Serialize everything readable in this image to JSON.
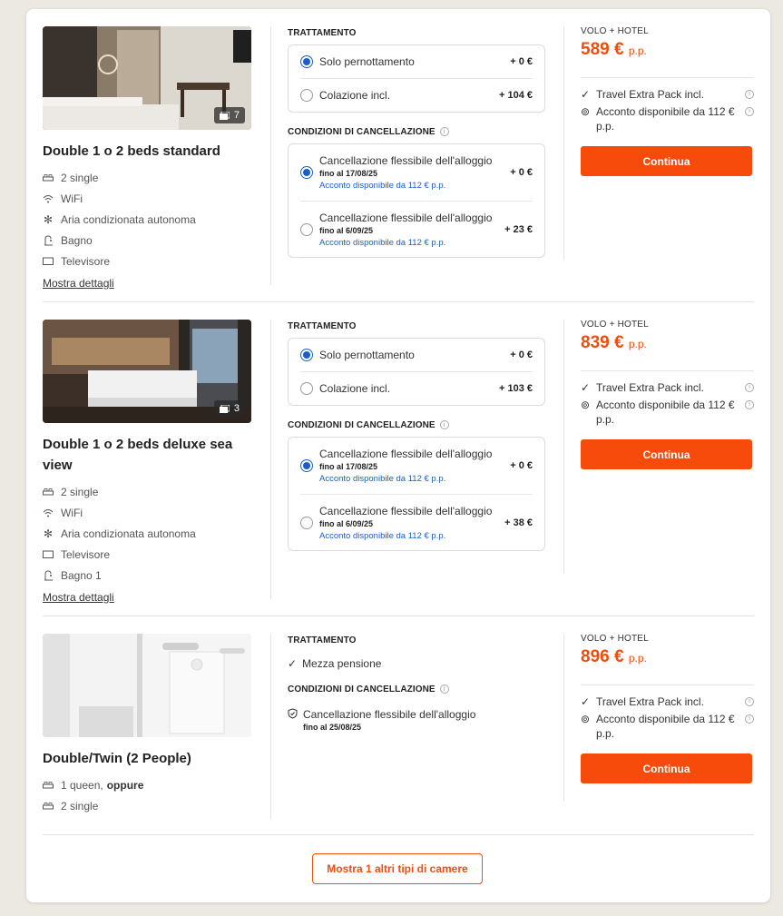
{
  "rooms": [
    {
      "photo_count": "7",
      "title": "Double 1 o 2 beds standard",
      "amenities": [
        {
          "icon": "bed-icon",
          "text": "2 single"
        },
        {
          "icon": "wifi-icon",
          "text": "WiFi"
        },
        {
          "icon": "snowflake-icon",
          "text": "Aria condizionata autonoma"
        },
        {
          "icon": "bath-icon",
          "text": "Bagno"
        },
        {
          "icon": "tv-icon",
          "text": "Televisore"
        }
      ],
      "details_link": "Mostra dettagli",
      "treatment_heading": "TRATTAMENTO",
      "treatments": [
        {
          "label": "Solo pernottamento",
          "price": "+ 0 €",
          "selected": true
        },
        {
          "label": "Colazione incl.",
          "price": "+ 104 €",
          "selected": false
        }
      ],
      "cancel_heading": "CONDIZIONI DI CANCELLAZIONE",
      "cancellations": [
        {
          "label": "Cancellazione flessibile dell'alloggio",
          "until": "fino al 17/08/25",
          "deposit": "Acconto disponibile da 112 € p.p.",
          "price": "+ 0 €",
          "selected": true
        },
        {
          "label": "Cancellazione flessibile dell'alloggio",
          "until": "fino al 6/09/25",
          "deposit": "Acconto disponibile da 112 € p.p.",
          "price": "+ 23 €",
          "selected": false
        }
      ],
      "label": "VOLO + HOTEL",
      "price": "589 €",
      "price_unit": "p.p.",
      "perk1": "Travel Extra Pack incl.",
      "perk2": "Acconto disponibile da 112 € p.p.",
      "button": "Continua"
    },
    {
      "photo_count": "3",
      "title": "Double 1 o 2 beds deluxe sea view",
      "amenities": [
        {
          "icon": "bed-icon",
          "text": "2 single"
        },
        {
          "icon": "wifi-icon",
          "text": "WiFi"
        },
        {
          "icon": "snowflake-icon",
          "text": "Aria condizionata autonoma"
        },
        {
          "icon": "tv-icon",
          "text": "Televisore"
        },
        {
          "icon": "bath-icon",
          "text": "Bagno 1"
        }
      ],
      "details_link": "Mostra dettagli",
      "treatment_heading": "TRATTAMENTO",
      "treatments": [
        {
          "label": "Solo pernottamento",
          "price": "+ 0 €",
          "selected": true
        },
        {
          "label": "Colazione incl.",
          "price": "+ 103 €",
          "selected": false
        }
      ],
      "cancel_heading": "CONDIZIONI DI CANCELLAZIONE",
      "cancellations": [
        {
          "label": "Cancellazione flessibile dell'alloggio",
          "until": "fino al 17/08/25",
          "deposit": "Acconto disponibile da 112 € p.p.",
          "price": "+ 0 €",
          "selected": true
        },
        {
          "label": "Cancellazione flessibile dell'alloggio",
          "until": "fino al 6/09/25",
          "deposit": "Acconto disponibile da 112 € p.p.",
          "price": "+ 38 €",
          "selected": false
        }
      ],
      "label": "VOLO + HOTEL",
      "price": "839 €",
      "price_unit": "p.p.",
      "perk1": "Travel Extra Pack incl.",
      "perk2": "Acconto disponibile da 112 € p.p.",
      "button": "Continua"
    },
    {
      "title": "Double/Twin (2 People)",
      "amenities": [
        {
          "icon": "bed-icon",
          "text": "1 queen,",
          "bold": "oppure"
        },
        {
          "icon": "bed-icon",
          "text": "2 single"
        }
      ],
      "treatment_heading": "TRATTAMENTO",
      "treatment_fixed": "Mezza pensione",
      "cancel_heading": "CONDIZIONI DI CANCELLAZIONE",
      "cancel_fixed": "Cancellazione flessibile dell'alloggio",
      "cancel_fixed_until": "fino al 25/08/25",
      "label": "VOLO + HOTEL",
      "price": "896 €",
      "price_unit": "p.p.",
      "perk1": "Travel Extra Pack incl.",
      "perk2": "Acconto disponibile da 112 € p.p.",
      "button": "Continua"
    }
  ],
  "more_rooms_button": "Mostra 1 altri tipi di camere",
  "colors": {
    "accent": "#f74b0b",
    "price": "#f04e0c",
    "link": "#1a5fc7"
  }
}
